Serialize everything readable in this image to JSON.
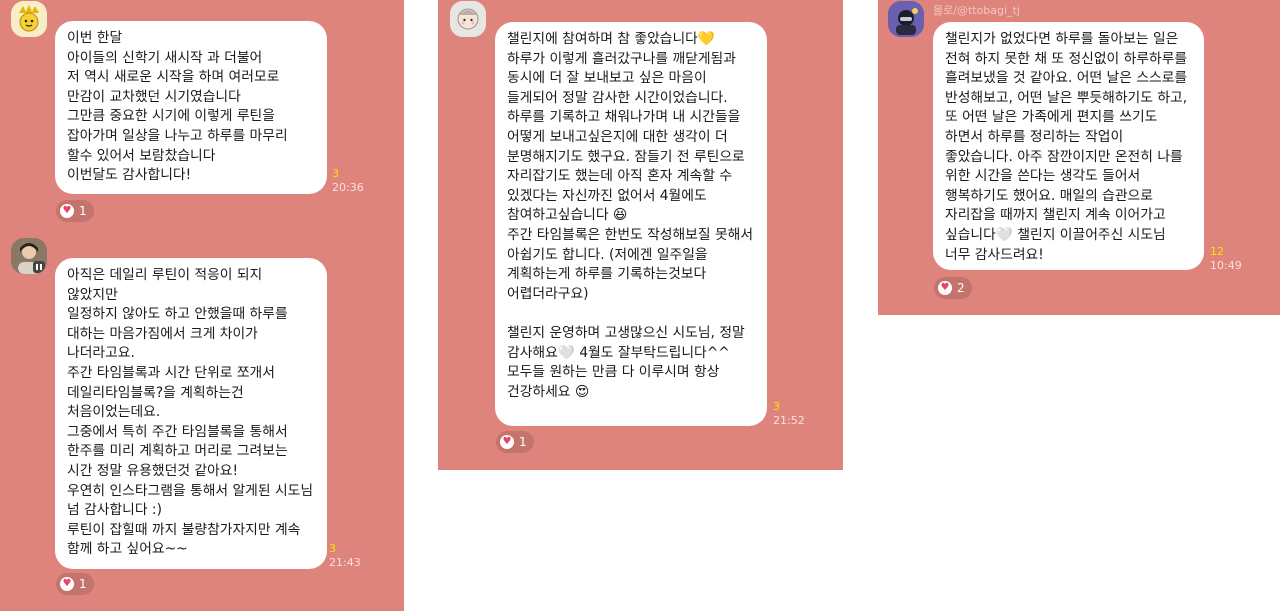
{
  "colors": {
    "panel": "#df847c",
    "unread": "#f7e400",
    "heart": "#e8436b"
  },
  "chats": [
    {
      "sender": "",
      "messages": [
        {
          "text": "이번 한달\n아이들의 신학기 새시작 과 더불어\n저 역시 새로운 시작을 하며 여러모로 만감이 교차했던 시기였습니다\n그만큼 중요한 시기에 이렇게 루틴을 잡아가며 일상을 나누고 하루를 마무리 할수 있어서 보람찼습니다\n이번달도 감사합니다!",
          "unread": "3",
          "time": "20:36",
          "reaction_count": "1"
        },
        {
          "text": "아직은 데일리 루틴이 적응이 되지 않았지만\n일정하지 않아도 하고 안했을때 하루를 대하는 마음가짐에서 크게 차이가 나더라고요.\n주간 타임블록과 시간 단위로 쪼개서 데일리타임블록?을 계획하는건 처음이었는데요.\n그중에서 특히 주간 타임블록을 통해서 한주를 미리 계획하고 머리로 그려보는 시간 정말 유용했던것 같아요!\n우연히 인스타그램을 통해서 알게된 시도님 넘 감사합니다 :)\n루틴이 잡힐때 까지 불량참가자지만 계속 함께 하고 싶어요~~",
          "unread": "3",
          "time": "21:43",
          "reaction_count": "1"
        }
      ]
    },
    {
      "sender": "",
      "messages": [
        {
          "text": "챌린지에 참여하며 참 좋았습니다💛\n하루가 이렇게 흘러갔구나를 깨닫게됨과 동시에 더 잘 보내보고 싶은 마음이 들게되어 정말 감사한 시간이었습니다.\n하루를 기록하고 채워나가며 내 시간들을 어떻게 보내고싶은지에 대한 생각이 더 분명해지기도 했구요. 잠들기 전 루틴으로 자리잡기도 했는데 아직 혼자 계속할 수 있겠다는 자신까진 없어서 4월에도 참여하고싶습니다 😆\n주간 타임블록은 한번도 작성해보질 못해서 아쉽기도 합니다. (저에겐 일주일을 계획하는게 하루를 기록하는것보다 어렵더라구요)\n\n챌린지 운영하며 고생많으신 시도님, 정말 감사해요🤍 4월도 잘부탁드립니다^^\n모두들 원하는 만큼 다 이루시며 항상 건강하세요 😍",
          "unread": "3",
          "time": "21:52",
          "reaction_count": "1"
        }
      ]
    },
    {
      "sender": "몰로/@ttobagi_tj",
      "messages": [
        {
          "text": "챌린지가 없었다면 하루를 돌아보는 일은 전혀 하지 못한 채 또 정신없이 하루하루를 흘려보냈을 것 같아요. 어떤 날은 스스로를 반성해보고, 어떤 날은 뿌듯해하기도 하고, 또 어떤 날은 가족에게 편지를 쓰기도 하면서 하루를 정리하는 작업이 좋았습니다. 아주 잠깐이지만 온전히 나를 위한 시간을 쓴다는 생각도 들어서 행복하기도 했어요. 매일의 습관으로 자리잡을 때까지 챌린지 계속 이어가고 싶습니다🤍 챌린지 이끌어주신 시도님 너무 감사드려요!",
          "unread": "12",
          "time": "10:49",
          "reaction_count": "2"
        }
      ]
    }
  ]
}
